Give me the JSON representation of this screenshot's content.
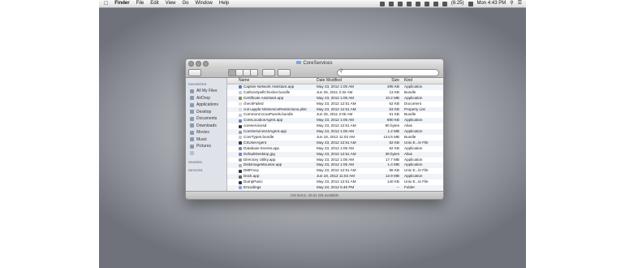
{
  "menubar": {
    "apple": "",
    "app": "Finder",
    "menus": [
      "File",
      "Edit",
      "View",
      "Go",
      "Window",
      "Help"
    ],
    "clock": "Mon 4:43 PM",
    "battery": "(6:25)"
  },
  "window": {
    "title": "CoreServices",
    "status": "119 items, 40.61 GB available"
  },
  "sidebar": {
    "favorites_heading": "FAVORITES",
    "favorites": [
      "All My Files",
      "AirDrop",
      "Applications",
      "Desktop",
      "Documents",
      "Downloads",
      "Movies",
      "Music",
      "Pictures"
    ],
    "shared_heading": "SHARED",
    "devices_heading": "DEVICES"
  },
  "columns": {
    "name": "Name",
    "date": "Date Modified",
    "size": "Size",
    "kind": "Kind"
  },
  "files": [
    {
      "name": "Captive Network Assistant.app",
      "date": "May 23, 2012 1:05 AM",
      "size": "495 KB",
      "kind": "Application",
      "color": "#5a7fb0"
    },
    {
      "name": "CarbonSpellChecker.bundle",
      "date": "Jun 25, 2011 2:32 AM",
      "size": "13 KB",
      "kind": "Bundle",
      "color": "#c8c8c8"
    },
    {
      "name": "Certificate Assistant.app",
      "date": "May 23, 2012 1:05 AM",
      "size": "10.2 MB",
      "kind": "Application",
      "color": "#7a9a60"
    },
    {
      "name": "checkFailed",
      "date": "May 23, 2012 12:51 AM",
      "size": "62 KB",
      "kind": "Document",
      "color": "#d9d9d9"
    },
    {
      "name": "com.apple.NSServiceRestrictions.plist",
      "date": "May 23, 2012 12:51 AM",
      "size": "63 KB",
      "kind": "Property List",
      "color": "#d9d9d9"
    },
    {
      "name": "CommonCocoaPanels.bundle",
      "date": "Jun 25, 2011 2:05 AM",
      "size": "61 KB",
      "kind": "Bundle",
      "color": "#c8c8c8"
    },
    {
      "name": "CoreLocationAgent.app",
      "date": "May 23, 2012 1:05 AM",
      "size": "890 KB",
      "kind": "Application",
      "color": "#6c8cc0"
    },
    {
      "name": "coreservicesd",
      "date": "May 23, 2012 12:51 AM",
      "size": "90 bytes",
      "kind": "Alias",
      "color": "#3a3a3a"
    },
    {
      "name": "CoreServicesUIAgent.app",
      "date": "May 23, 2012 1:05 AM",
      "size": "1.2 MB",
      "kind": "Application",
      "color": "#8aa0b8"
    },
    {
      "name": "CoreTypes.bundle",
      "date": "Jun 18, 2012 11:02 AM",
      "size": "124.5 MB",
      "kind": "Bundle",
      "color": "#c8c8c8"
    },
    {
      "name": "CSUserAgent",
      "date": "May 23, 2012 12:51 AM",
      "size": "62 KB",
      "kind": "Unix E...le File",
      "color": "#3a3a3a"
    },
    {
      "name": "Database Events.app",
      "date": "May 23, 2012 1:05 AM",
      "size": "62 KB",
      "kind": "Application",
      "color": "#8a8a8a"
    },
    {
      "name": "DefaultDesktop.jpg",
      "date": "May 23, 2012 12:51 AM",
      "size": "39 bytes",
      "kind": "Alias",
      "color": "#6f8fbf"
    },
    {
      "name": "Directory Utility.app",
      "date": "May 23, 2012 1:05 AM",
      "size": "17.7 MB",
      "kind": "Application",
      "color": "#9a9a9a"
    },
    {
      "name": "DiskImageMounter.app",
      "date": "May 23, 2012 1:05 AM",
      "size": "1.4 MB",
      "kind": "Application",
      "color": "#b0b0b0"
    },
    {
      "name": "DMProxy",
      "date": "May 23, 2012 12:51 AM",
      "size": "86 KB",
      "kind": "Unix E...le File",
      "color": "#3a3a3a"
    },
    {
      "name": "Dock.app",
      "date": "Jun 18, 2012 11:02 AM",
      "size": "12.9 MB",
      "kind": "Application",
      "color": "#6a6a6a"
    },
    {
      "name": "DumpPanic",
      "date": "May 23, 2012 12:51 AM",
      "size": "140 KB",
      "kind": "Unix E...le File",
      "color": "#3a3a3a"
    },
    {
      "name": "Encodings",
      "date": "May 23, 2012 5:46 PM",
      "size": "--",
      "kind": "Folder",
      "color": "#7fa7d6"
    }
  ]
}
